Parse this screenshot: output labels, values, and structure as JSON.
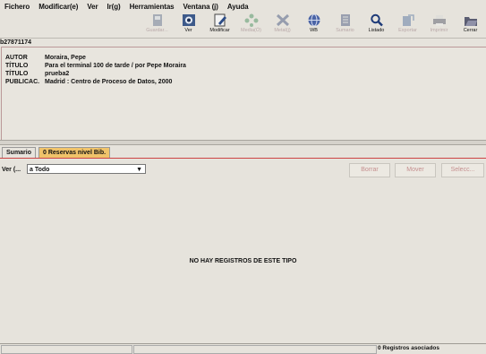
{
  "menu": [
    {
      "label": "Fichero",
      "key": "F"
    },
    {
      "label": "Modificar(e)",
      "key": ""
    },
    {
      "label": "Ver",
      "key": "V"
    },
    {
      "label": "Ir(g)",
      "key": ""
    },
    {
      "label": "Herramientas",
      "key": ""
    },
    {
      "label": "Ventana (j)",
      "key": ""
    },
    {
      "label": "Ayuda",
      "key": "A"
    }
  ],
  "toolbar": [
    {
      "label": "Guardar...",
      "icon": "save-icon",
      "enabled": false
    },
    {
      "label": "Ver",
      "icon": "view-icon",
      "enabled": true
    },
    {
      "label": "Modificar",
      "icon": "edit-icon",
      "enabled": true
    },
    {
      "label": "Media(Ó)",
      "icon": "media-icon",
      "enabled": false
    },
    {
      "label": "Metal(j)",
      "icon": "metal-icon",
      "enabled": false
    },
    {
      "label": "WB",
      "icon": "web-icon",
      "enabled": true
    },
    {
      "label": "Sumario",
      "icon": "summary-icon",
      "enabled": false
    },
    {
      "label": "Listado",
      "icon": "search-icon",
      "enabled": true
    },
    {
      "label": "Exportar",
      "icon": "export-icon",
      "enabled": false
    },
    {
      "label": "Imprimir",
      "icon": "print-icon",
      "enabled": false
    },
    {
      "label": "Cerrar",
      "icon": "folder-icon",
      "enabled": true
    }
  ],
  "record": {
    "number": "b27871174",
    "fields": [
      {
        "key": "AUTOR",
        "value": "Moraira, Pepe"
      },
      {
        "key": "TÍTULO",
        "value": "Para el terminal 100 de tarde / por Pepe Moraira"
      },
      {
        "key": "TÍTULO",
        "value": "prueba2"
      },
      {
        "key": "PUBLICAC.",
        "value": "Madrid : Centro de Proceso de Datos, 2000"
      }
    ]
  },
  "tabs": [
    {
      "label": "Sumario",
      "active": true
    },
    {
      "label": "0 Reservas nivel Bib.",
      "active": false
    }
  ],
  "view": {
    "label": "Ver (...",
    "selected": "a Todo"
  },
  "buttons": {
    "borrar": "Borrar",
    "mover": "Mover",
    "seleccionar": "Selecc..."
  },
  "empty_message": "NO HAY REGISTROS DE ESTE TIPO",
  "status": {
    "text": "0 Registros asociados"
  },
  "colors": {
    "accent": "#f0c36a",
    "record_border": "#b99",
    "disabled_text": "#c58f8f"
  }
}
